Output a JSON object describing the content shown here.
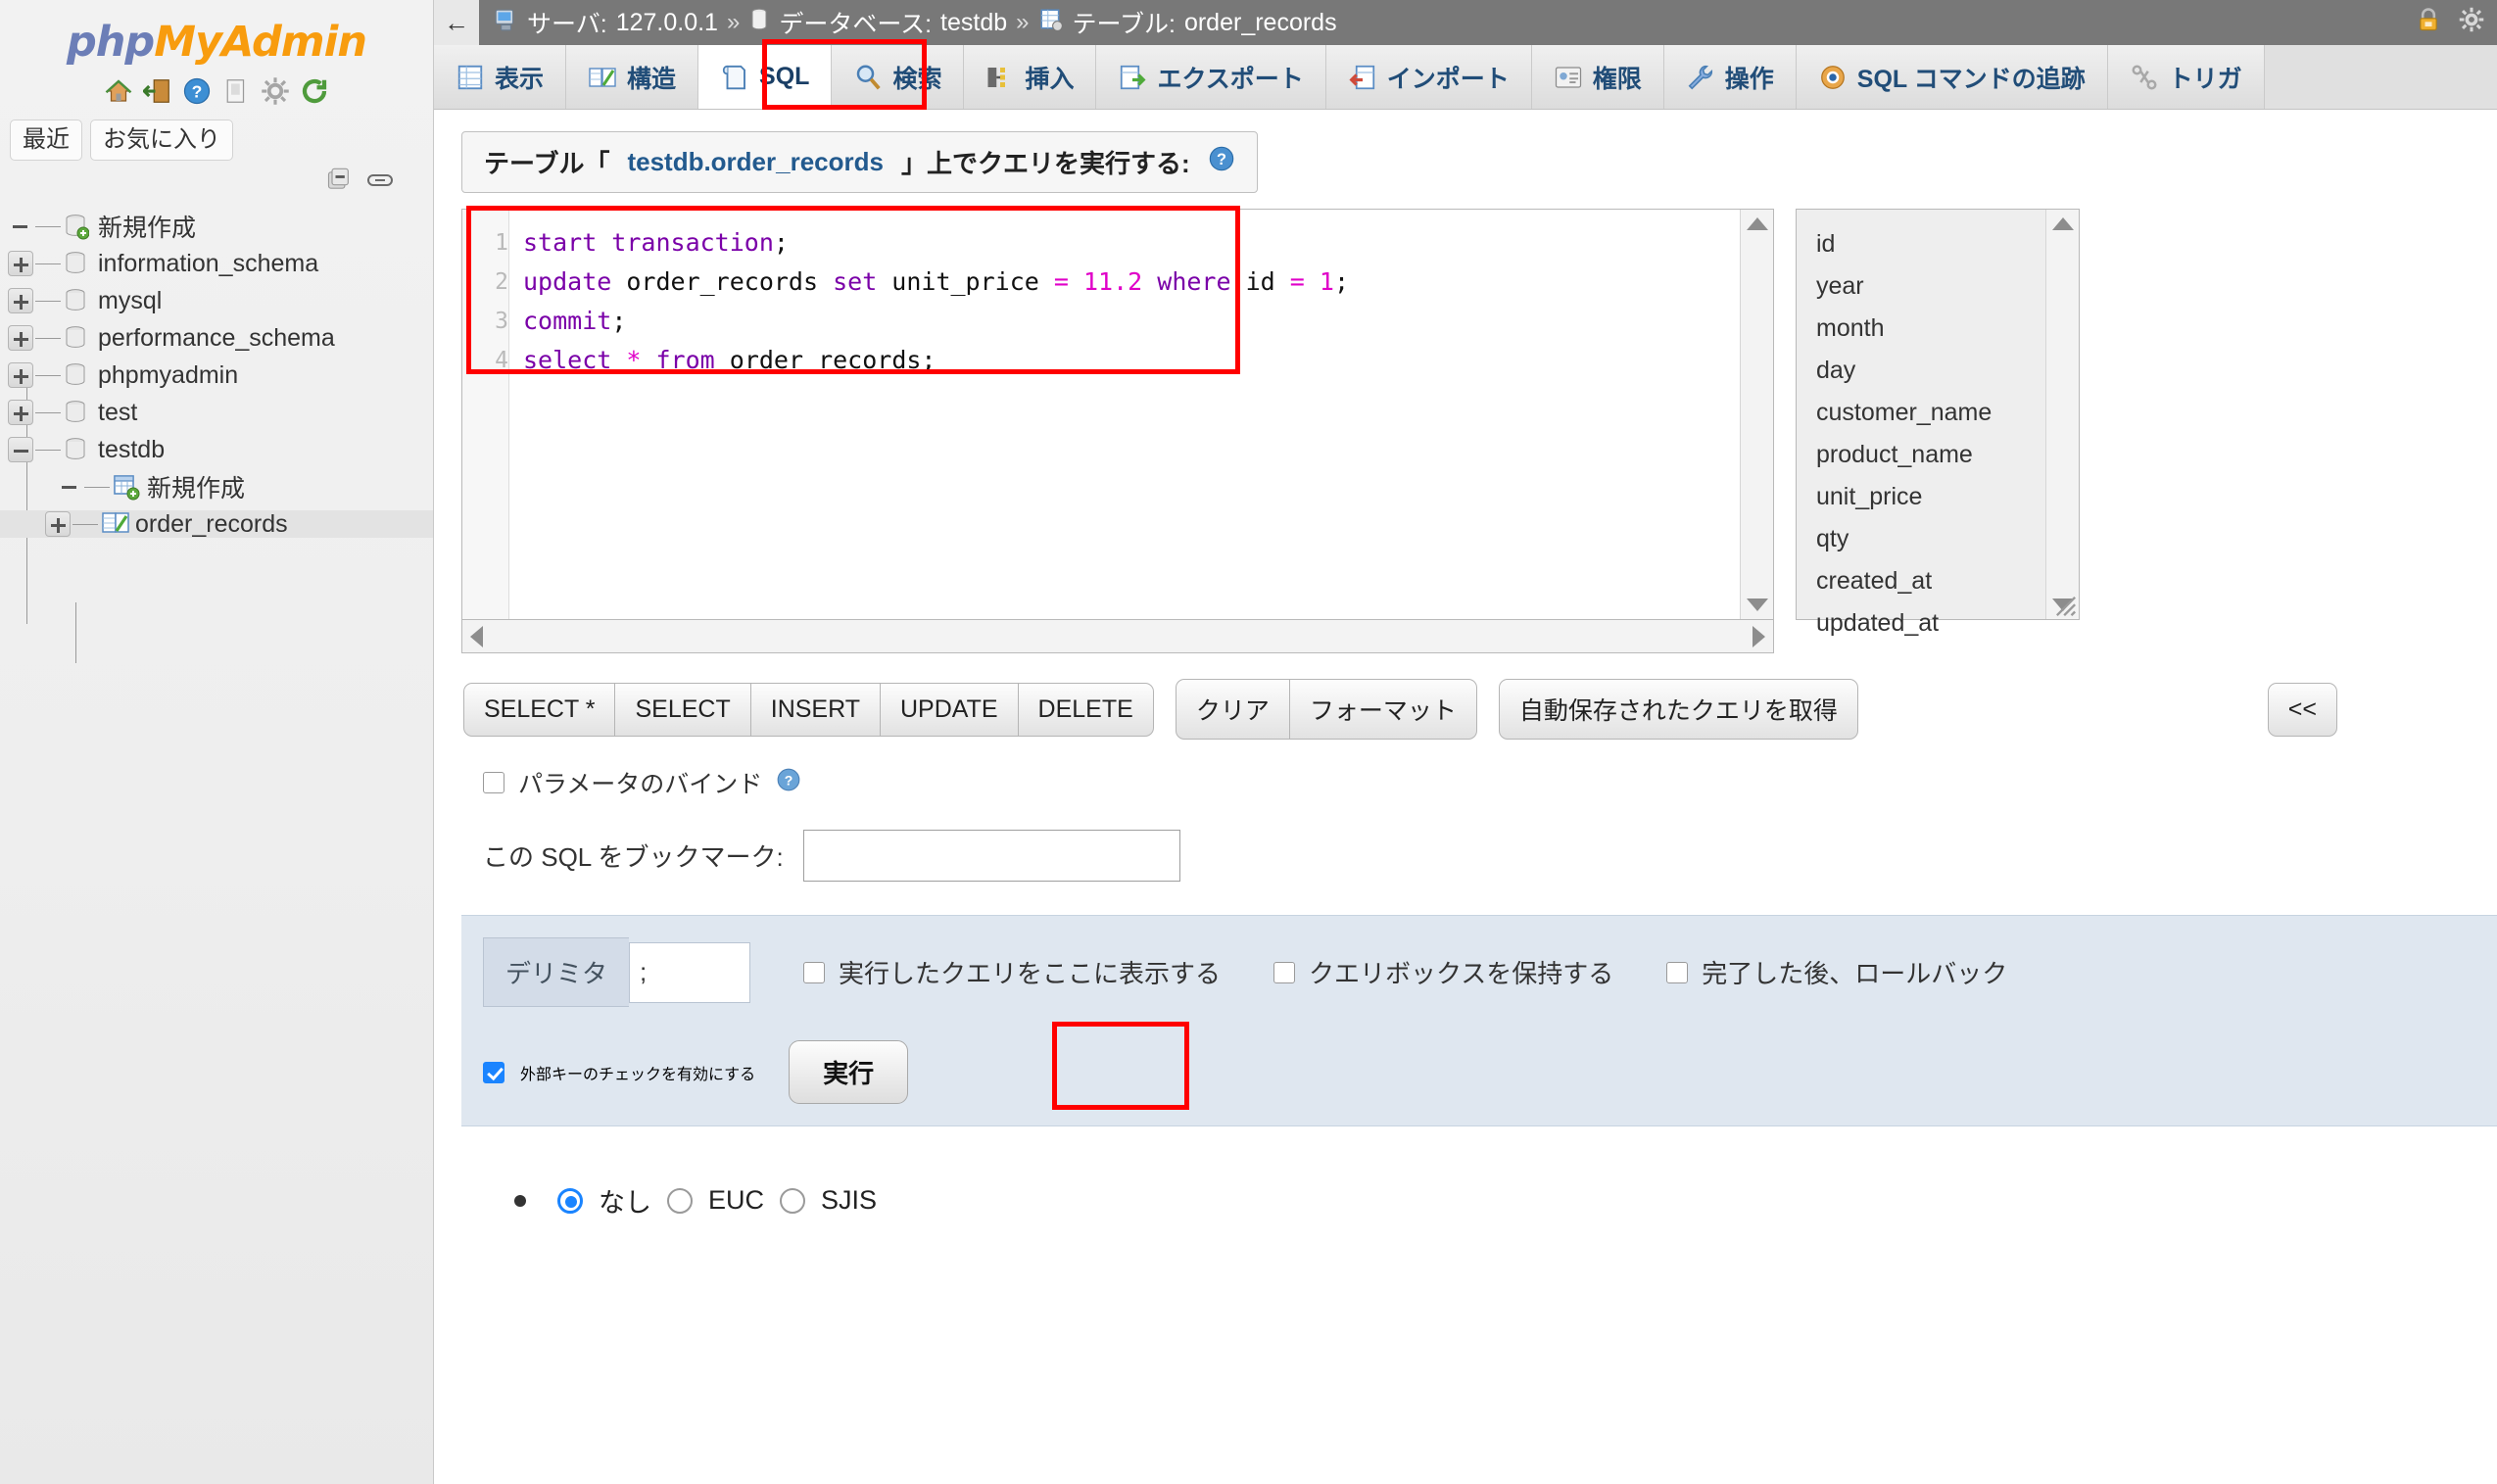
{
  "brand": {
    "php": "php",
    "my": "My",
    "admin": "Admin"
  },
  "sidebar": {
    "nav_icons": [
      "home-icon",
      "logout-icon",
      "help-icon",
      "docs-icon",
      "settings-icon",
      "reload-icon"
    ],
    "quick_tabs": [
      {
        "label": "最近",
        "name": "recent-tab"
      },
      {
        "label": "お気に入り",
        "name": "favorites-tab"
      }
    ],
    "tree_tools": [
      "collapse-all-icon",
      "link-toggle-icon"
    ],
    "tree": [
      {
        "label": "新規作成",
        "icon": "database-new-icon",
        "toggle": "none",
        "indent": 0,
        "selected": false
      },
      {
        "label": "information_schema",
        "icon": "database-icon",
        "toggle": "plus",
        "indent": 0,
        "selected": false
      },
      {
        "label": "mysql",
        "icon": "database-icon",
        "toggle": "plus",
        "indent": 0,
        "selected": false
      },
      {
        "label": "performance_schema",
        "icon": "database-icon",
        "toggle": "plus",
        "indent": 0,
        "selected": false
      },
      {
        "label": "phpmyadmin",
        "icon": "database-icon",
        "toggle": "plus",
        "indent": 0,
        "selected": false
      },
      {
        "label": "test",
        "icon": "database-icon",
        "toggle": "plus",
        "indent": 0,
        "selected": false
      },
      {
        "label": "testdb",
        "icon": "database-icon",
        "toggle": "minus",
        "indent": 0,
        "selected": false
      },
      {
        "label": "新規作成",
        "icon": "table-new-icon",
        "toggle": "none",
        "indent": 1,
        "selected": false
      },
      {
        "label": "order_records",
        "icon": "table-icon",
        "toggle": "plus",
        "indent": 1,
        "selected": true
      }
    ]
  },
  "topbar": {
    "back": "←",
    "server_label": "サーバ:",
    "server_value": "127.0.0.1",
    "db_label": "データベース:",
    "db_value": "testdb",
    "table_label": "テーブル:",
    "table_value": "order_records",
    "sep": "»",
    "right_icons": [
      "lock-icon",
      "gear-icon"
    ]
  },
  "tabs": [
    {
      "label": "表示",
      "icon": "browse-icon",
      "active": false
    },
    {
      "label": "構造",
      "icon": "structure-icon",
      "active": false
    },
    {
      "label": "SQL",
      "icon": "sql-icon",
      "active": true
    },
    {
      "label": "検索",
      "icon": "search-icon",
      "active": false
    },
    {
      "label": "挿入",
      "icon": "insert-icon",
      "active": false
    },
    {
      "label": "エクスポート",
      "icon": "export-icon",
      "active": false
    },
    {
      "label": "インポート",
      "icon": "import-icon",
      "active": false
    },
    {
      "label": "権限",
      "icon": "privileges-icon",
      "active": false
    },
    {
      "label": "操作",
      "icon": "operations-icon",
      "active": false
    },
    {
      "label": "SQL コマンドの追跡",
      "icon": "tracking-icon",
      "active": false
    },
    {
      "label": "トリガ",
      "icon": "triggers-icon",
      "active": false
    }
  ],
  "query_header": {
    "prefix": "テーブル「",
    "table": "testdb.order_records",
    "suffix": "」上でクエリを実行する:",
    "help_icon": "help-icon"
  },
  "editor": {
    "line_numbers": [
      "1",
      "2",
      "3",
      "4"
    ],
    "lines": [
      [
        {
          "t": "start transaction",
          "c": "kw"
        },
        {
          "t": ";",
          "c": "plain"
        }
      ],
      [
        {
          "t": "update",
          "c": "kw"
        },
        {
          "t": " order_records ",
          "c": "plain"
        },
        {
          "t": "set",
          "c": "kw"
        },
        {
          "t": " unit_price ",
          "c": "plain"
        },
        {
          "t": "=",
          "c": "op"
        },
        {
          "t": " ",
          "c": "plain"
        },
        {
          "t": "11.2",
          "c": "num"
        },
        {
          "t": " ",
          "c": "plain"
        },
        {
          "t": "where",
          "c": "kw"
        },
        {
          "t": " id ",
          "c": "plain"
        },
        {
          "t": "=",
          "c": "op"
        },
        {
          "t": " ",
          "c": "plain"
        },
        {
          "t": "1",
          "c": "num"
        },
        {
          "t": ";",
          "c": "plain"
        }
      ],
      [
        {
          "t": "commit",
          "c": "kw"
        },
        {
          "t": ";",
          "c": "plain"
        }
      ],
      [
        {
          "t": "select",
          "c": "kw"
        },
        {
          "t": " ",
          "c": "plain"
        },
        {
          "t": "*",
          "c": "op"
        },
        {
          "t": " ",
          "c": "plain"
        },
        {
          "t": "from",
          "c": "kw"
        },
        {
          "t": " order_records;",
          "c": "plain"
        }
      ]
    ]
  },
  "columns": [
    "id",
    "year",
    "month",
    "day",
    "customer_name",
    "product_name",
    "unit_price",
    "qty",
    "created_at",
    "updated_at"
  ],
  "buttons": {
    "group1": [
      "SELECT *",
      "SELECT",
      "INSERT",
      "UPDATE",
      "DELETE"
    ],
    "group2": [
      "クリア",
      "フォーマット"
    ],
    "group3": [
      "自動保存されたクエリを取得"
    ],
    "collapse": "<<"
  },
  "bind_params": {
    "label": "パラメータのバインド",
    "checked": false,
    "help_icon": "help-icon"
  },
  "bookmark": {
    "label": "この SQL をブックマーク:",
    "value": "",
    "placeholder": ""
  },
  "delimiter": {
    "label": "デリミタ",
    "value": ";"
  },
  "options": [
    {
      "label": "実行したクエリをここに表示する",
      "checked": false
    },
    {
      "label": "クエリボックスを保持する",
      "checked": false
    },
    {
      "label": "完了した後、ロールバック",
      "checked": false
    }
  ],
  "foreign_key": {
    "label": "外部キーのチェックを有効にする",
    "checked": true
  },
  "go_button": "実行",
  "charset_radios": [
    {
      "label": "なし",
      "checked": true
    },
    {
      "label": "EUC",
      "checked": false
    },
    {
      "label": "SJIS",
      "checked": false
    }
  ],
  "colors": {
    "accent": "#f89c0e",
    "brand_blue": "#6c7eb7",
    "highlight": "#ff0000",
    "keyword": "#7a00a8",
    "operator": "#e000c8",
    "link": "#214d78"
  }
}
